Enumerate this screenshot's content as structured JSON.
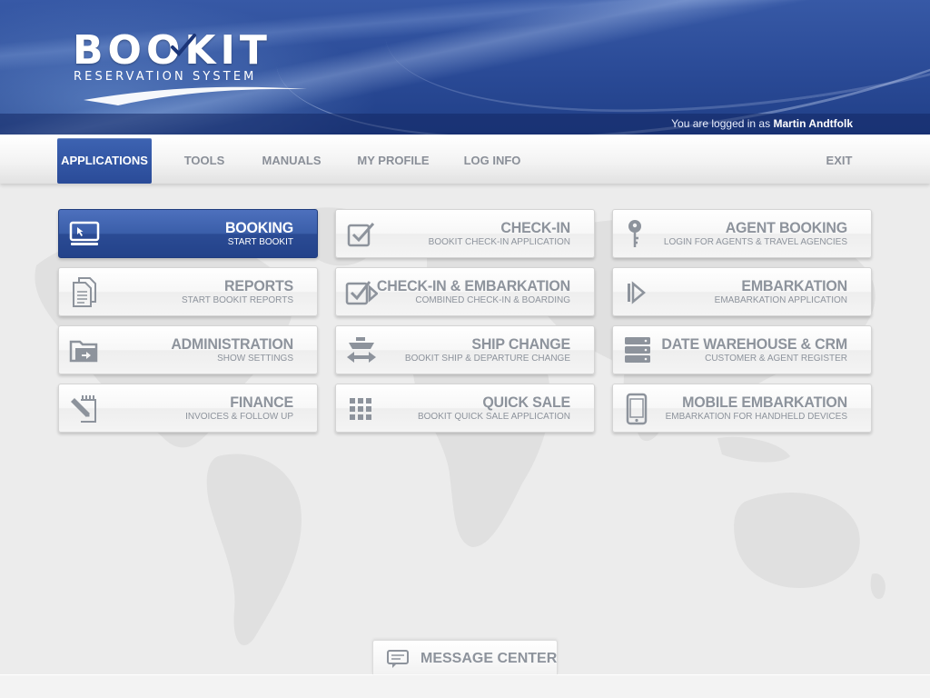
{
  "brand": {
    "name": "BOOKIT",
    "tagline": "RESERVATION SYSTEM"
  },
  "session": {
    "prefix": "You are logged in as",
    "user": "Martin Andtfolk"
  },
  "nav": {
    "items": [
      {
        "label": "APPLICATIONS",
        "active": true
      },
      {
        "label": "TOOLS"
      },
      {
        "label": "MANUALS"
      },
      {
        "label": "MY PROFILE"
      },
      {
        "label": "LOG INFO"
      }
    ],
    "exit_label": "EXIT"
  },
  "tiles": [
    {
      "title": "BOOKING",
      "subtitle": "START BOOKIT",
      "icon": "monitor-icon",
      "active": true
    },
    {
      "title": "CHECK-IN",
      "subtitle": "BOOKIT CHECK-IN APPLICATION",
      "icon": "checkbox-icon"
    },
    {
      "title": "AGENT BOOKING",
      "subtitle": "LOGIN FOR AGENTS & TRAVEL AGENCIES",
      "icon": "key-icon"
    },
    {
      "title": "REPORTS",
      "subtitle": "START BOOKIT REPORTS",
      "icon": "documents-icon"
    },
    {
      "title": "CHECK-IN & EMBARKATION",
      "subtitle": "COMBINED CHECK-IN & BOARDING",
      "icon": "checkbox-arrow-icon"
    },
    {
      "title": "EMBARKATION",
      "subtitle": "EMABARKATION APPLICATION",
      "icon": "embark-arrow-icon"
    },
    {
      "title": "ADMINISTRATION",
      "subtitle": "SHOW SETTINGS",
      "icon": "folder-icon"
    },
    {
      "title": "SHIP CHANGE",
      "subtitle": "BOOKIT SHIP & DEPARTURE CHANGE",
      "icon": "ship-icon"
    },
    {
      "title": "DATE WAREHOUSE & CRM",
      "subtitle": "CUSTOMER & AGENT REGISTER",
      "icon": "database-icon"
    },
    {
      "title": "FINANCE",
      "subtitle": "INVOICES & FOLLOW UP",
      "icon": "notepad-pencil-icon"
    },
    {
      "title": "QUICK SALE",
      "subtitle": "BOOKIT QUICK SALE APPLICATION",
      "icon": "grid-icon"
    },
    {
      "title": "MOBILE EMBARKATION",
      "subtitle": "EMBARKATION FOR HANDHELD DEVICES",
      "icon": "phone-icon"
    }
  ],
  "message_center": {
    "label": "MESSAGE CENTER",
    "icon": "message-icon"
  },
  "colors": {
    "header_blue": "#2a4a96",
    "active_blue": "#2b4b94",
    "tile_text": "#8d939c"
  }
}
